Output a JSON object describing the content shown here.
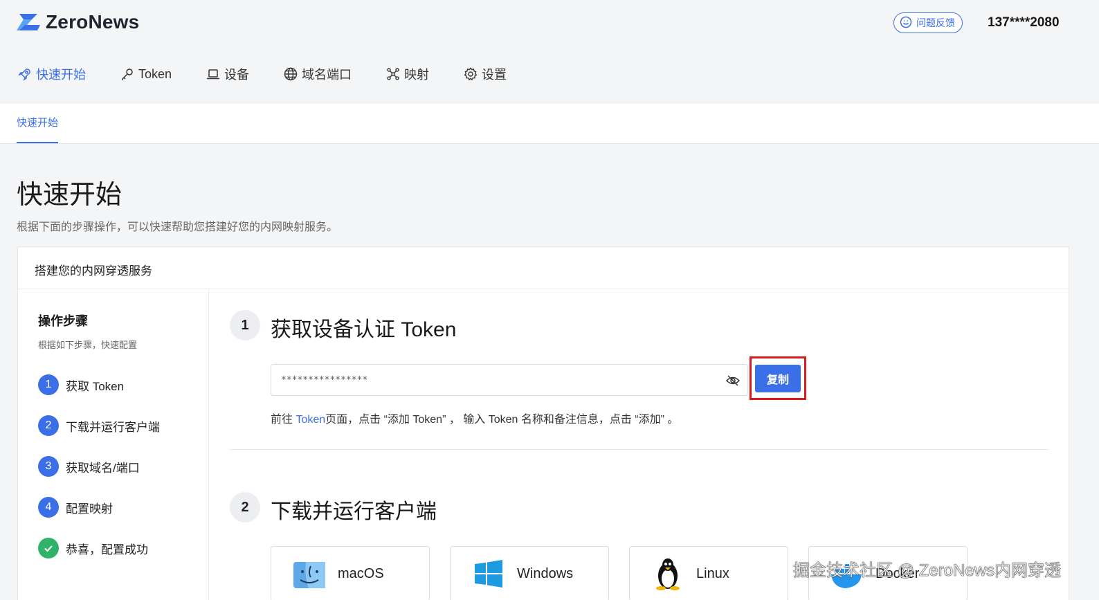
{
  "header": {
    "brand": "ZeroNews",
    "feedback_label": "问题反馈",
    "user_phone": "137****2080"
  },
  "nav": [
    {
      "label": "快速开始",
      "icon": "rocket-icon",
      "active": true
    },
    {
      "label": "Token",
      "icon": "key-icon",
      "active": false
    },
    {
      "label": "设备",
      "icon": "laptop-icon",
      "active": false
    },
    {
      "label": "域名端口",
      "icon": "globe-icon",
      "active": false
    },
    {
      "label": "映射",
      "icon": "mapping-icon",
      "active": false
    },
    {
      "label": "设置",
      "icon": "gear-icon",
      "active": false
    }
  ],
  "subtab": {
    "label": "快速开始"
  },
  "page": {
    "title": "快速开始",
    "description": "根据下面的步骤操作，可以快速帮助您搭建好您的内网映射服务。"
  },
  "card": {
    "title": "搭建您的内网穿透服务"
  },
  "steps": {
    "title": "操作步骤",
    "subtitle": "根据如下步骤，快速配置",
    "items": [
      {
        "num": "1",
        "label": "获取 Token",
        "done": false
      },
      {
        "num": "2",
        "label": "下载并运行客户端",
        "done": false
      },
      {
        "num": "3",
        "label": "获取域名/端口",
        "done": false
      },
      {
        "num": "4",
        "label": "配置映射",
        "done": false
      },
      {
        "num": "",
        "label": "恭喜，配置成功",
        "done": true
      }
    ]
  },
  "section1": {
    "num": "1",
    "title": "获取设备认证 Token",
    "token_value": "****************",
    "copy_label": "复制",
    "hint_prefix": "前往 ",
    "hint_link": "Token",
    "hint_suffix": "页面，点击 “添加 Token” ， 输入 Token 名称和备注信息，点击 “添加” 。"
  },
  "section2": {
    "num": "2",
    "title": "下载并运行客户端",
    "platforms": [
      {
        "label": "macOS",
        "icon": "macos-finder-icon"
      },
      {
        "label": "Windows",
        "icon": "windows-icon"
      },
      {
        "label": "Linux",
        "icon": "linux-penguin-icon"
      },
      {
        "label": "Docker",
        "icon": "docker-icon"
      }
    ]
  },
  "watermark": "掘金技术社区 @ ZeroNews内网穿透",
  "colors": {
    "accent": "#3a6fe8",
    "success": "#2fb26a",
    "highlight_box": "#d91a1a"
  }
}
